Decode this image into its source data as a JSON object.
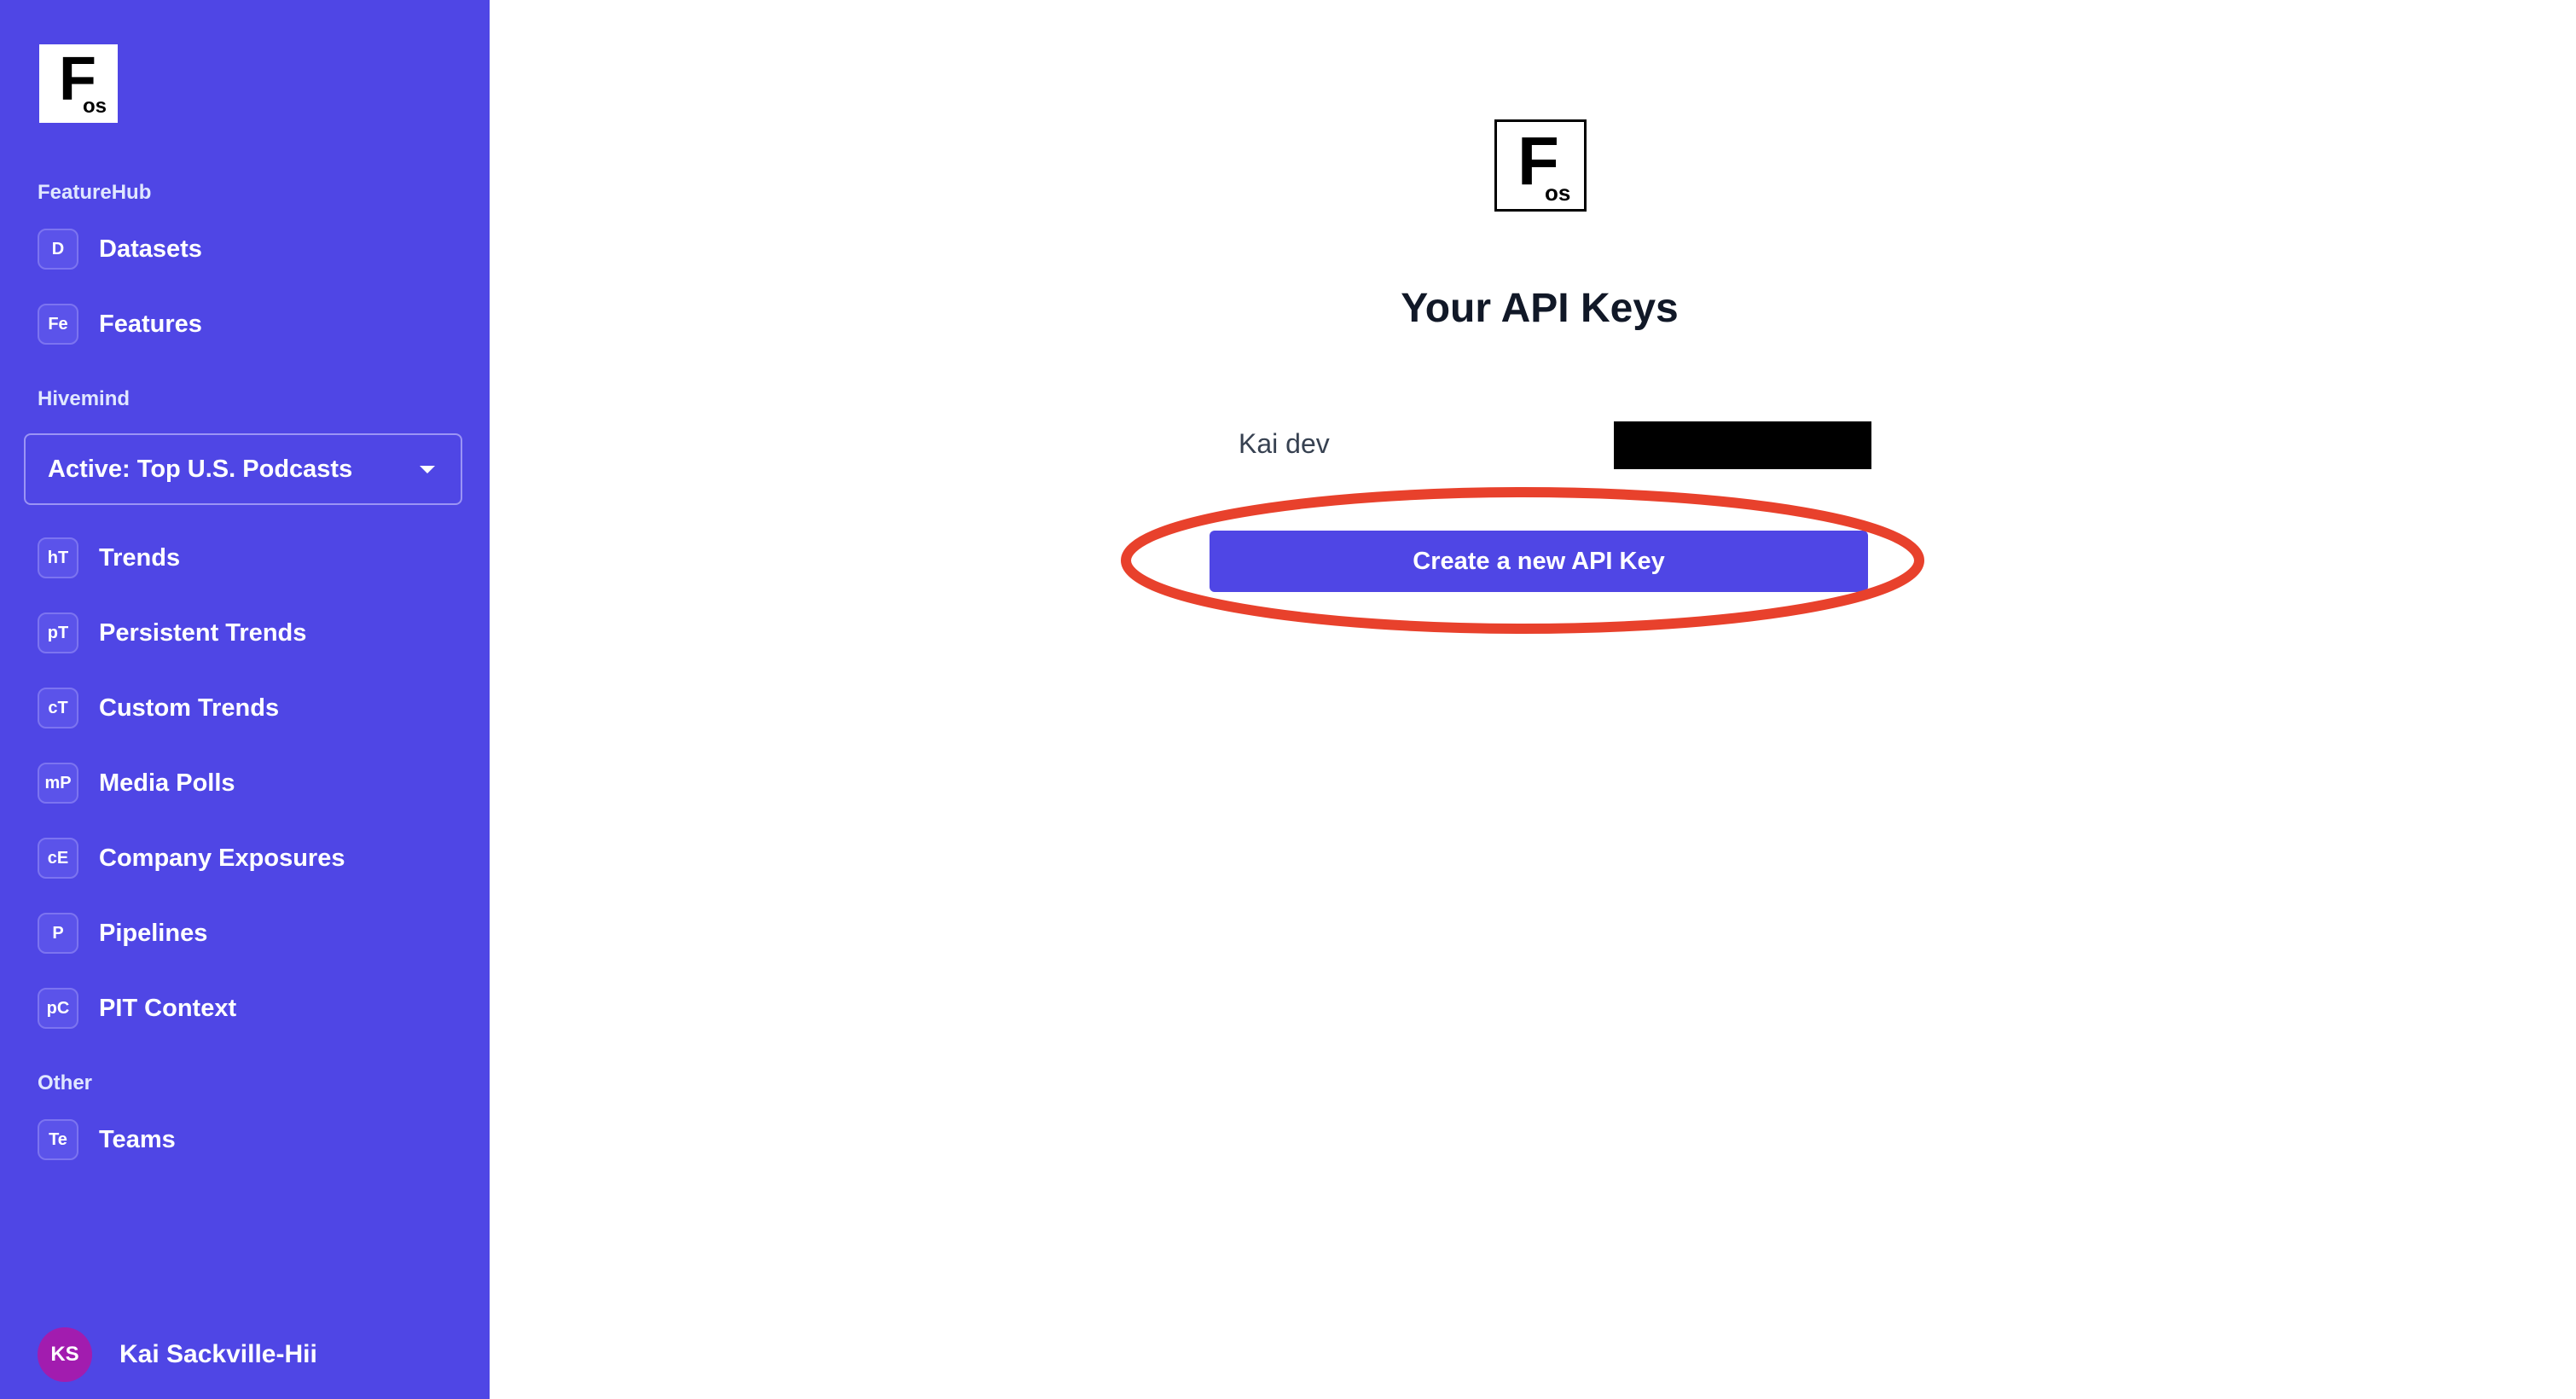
{
  "sidebar": {
    "logo": {
      "letter": "F",
      "subscript": "os"
    },
    "sections": {
      "featurehub": "FeatureHub",
      "hivemind": "Hivemind",
      "other": "Other"
    },
    "featurehub_items": [
      {
        "badge": "D",
        "label": "Datasets"
      },
      {
        "badge": "Fe",
        "label": "Features"
      }
    ],
    "team_select": {
      "value": "Active: Top U.S. Podcasts"
    },
    "hivemind_items": [
      {
        "badge": "hT",
        "label": "Trends"
      },
      {
        "badge": "pT",
        "label": "Persistent Trends"
      },
      {
        "badge": "cT",
        "label": "Custom Trends"
      },
      {
        "badge": "mP",
        "label": "Media Polls"
      },
      {
        "badge": "cE",
        "label": "Company Exposures"
      },
      {
        "badge": "P",
        "label": "Pipelines"
      },
      {
        "badge": "pC",
        "label": "PIT Context"
      }
    ],
    "other_items": [
      {
        "badge": "Te",
        "label": "Teams"
      }
    ],
    "user": {
      "initials": "KS",
      "name": "Kai Sackville-Hii"
    }
  },
  "main": {
    "logo": {
      "letter": "F",
      "subscript": "os"
    },
    "title": "Your API Keys",
    "api_keys": [
      {
        "name": "Kai dev",
        "value_redacted": true
      }
    ],
    "create_button_label": "Create a new API Key"
  },
  "colors": {
    "sidebar_bg": "#4f46e5",
    "button_bg": "#4f46e5",
    "highlight_ring": "#e8412c",
    "avatar_bg": "#a21caf"
  }
}
